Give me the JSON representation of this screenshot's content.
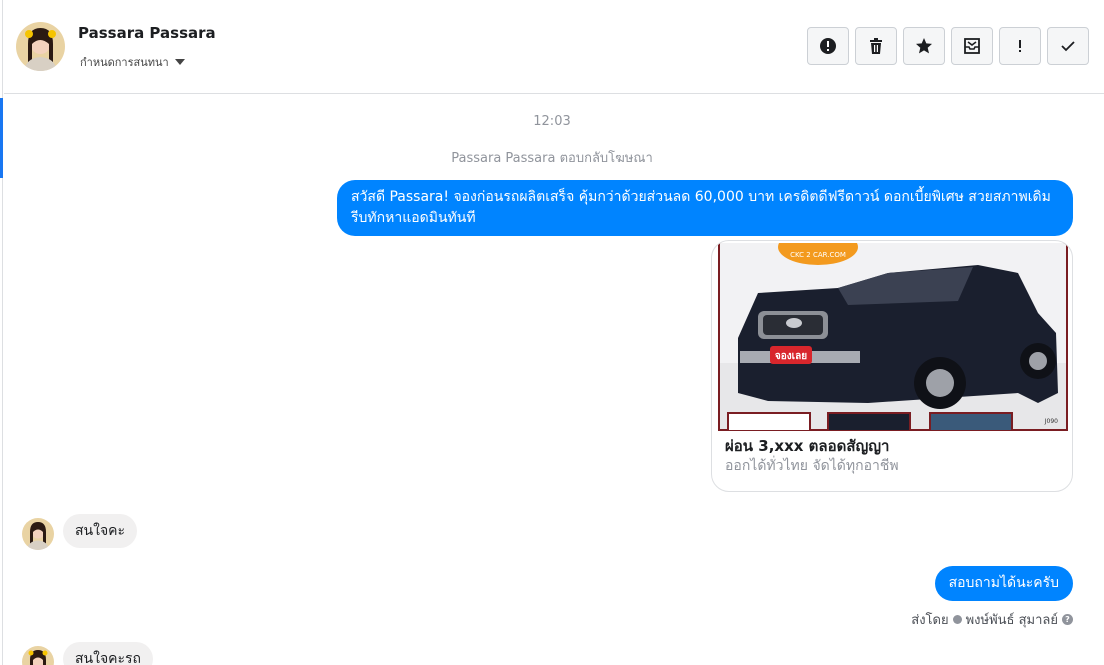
{
  "header": {
    "contact_name": "Passara Passara",
    "assign_label": "กำหนดการสนทนา",
    "actions": [
      {
        "icon": "alert-circle-icon"
      },
      {
        "icon": "trash-icon"
      },
      {
        "icon": "star-icon"
      },
      {
        "icon": "archive-inbox-icon"
      },
      {
        "icon": "exclamation-icon"
      },
      {
        "icon": "checkmark-icon"
      }
    ]
  },
  "conversation": {
    "time": "12:03",
    "ad_reply_note": "Passara Passara ตอบกลับโฆษณา",
    "messages": [
      {
        "direction": "out",
        "text": "สวัสดี Passara! จองก่อนรถผลิตเสร็จ คุ้มกว่าด้วยส่วนลด 60,000 บาท เครดิตดีฟรีดาวน์ ดอกเบี้ยพิเศษ สวยสภาพเดิม รีบทักหาแอดมินทันที"
      },
      {
        "direction": "in",
        "text": "สนใจคะ"
      },
      {
        "direction": "out",
        "text": "สอบถามได้นะครับ"
      },
      {
        "direction": "in",
        "text": "สนใจคะรถ"
      }
    ],
    "ad_card": {
      "title": "ผ่อน 3,xxx ตลอดสัญญา",
      "subtitle": "ออกได้ทั่วไทย จัดได้ทุกอาชีพ",
      "logo_text": "CKC 2 CAR.COM",
      "badge_text": "จองเลย",
      "code_text": "J090"
    },
    "sent_by": {
      "prefix": "ส่งโดย",
      "name": "พงษ์พันธ์ สุมาลย์"
    }
  },
  "colors": {
    "outgoing_bubble": "#0084ff",
    "incoming_bubble": "#f1f0f0",
    "accent": "#1877f2"
  }
}
